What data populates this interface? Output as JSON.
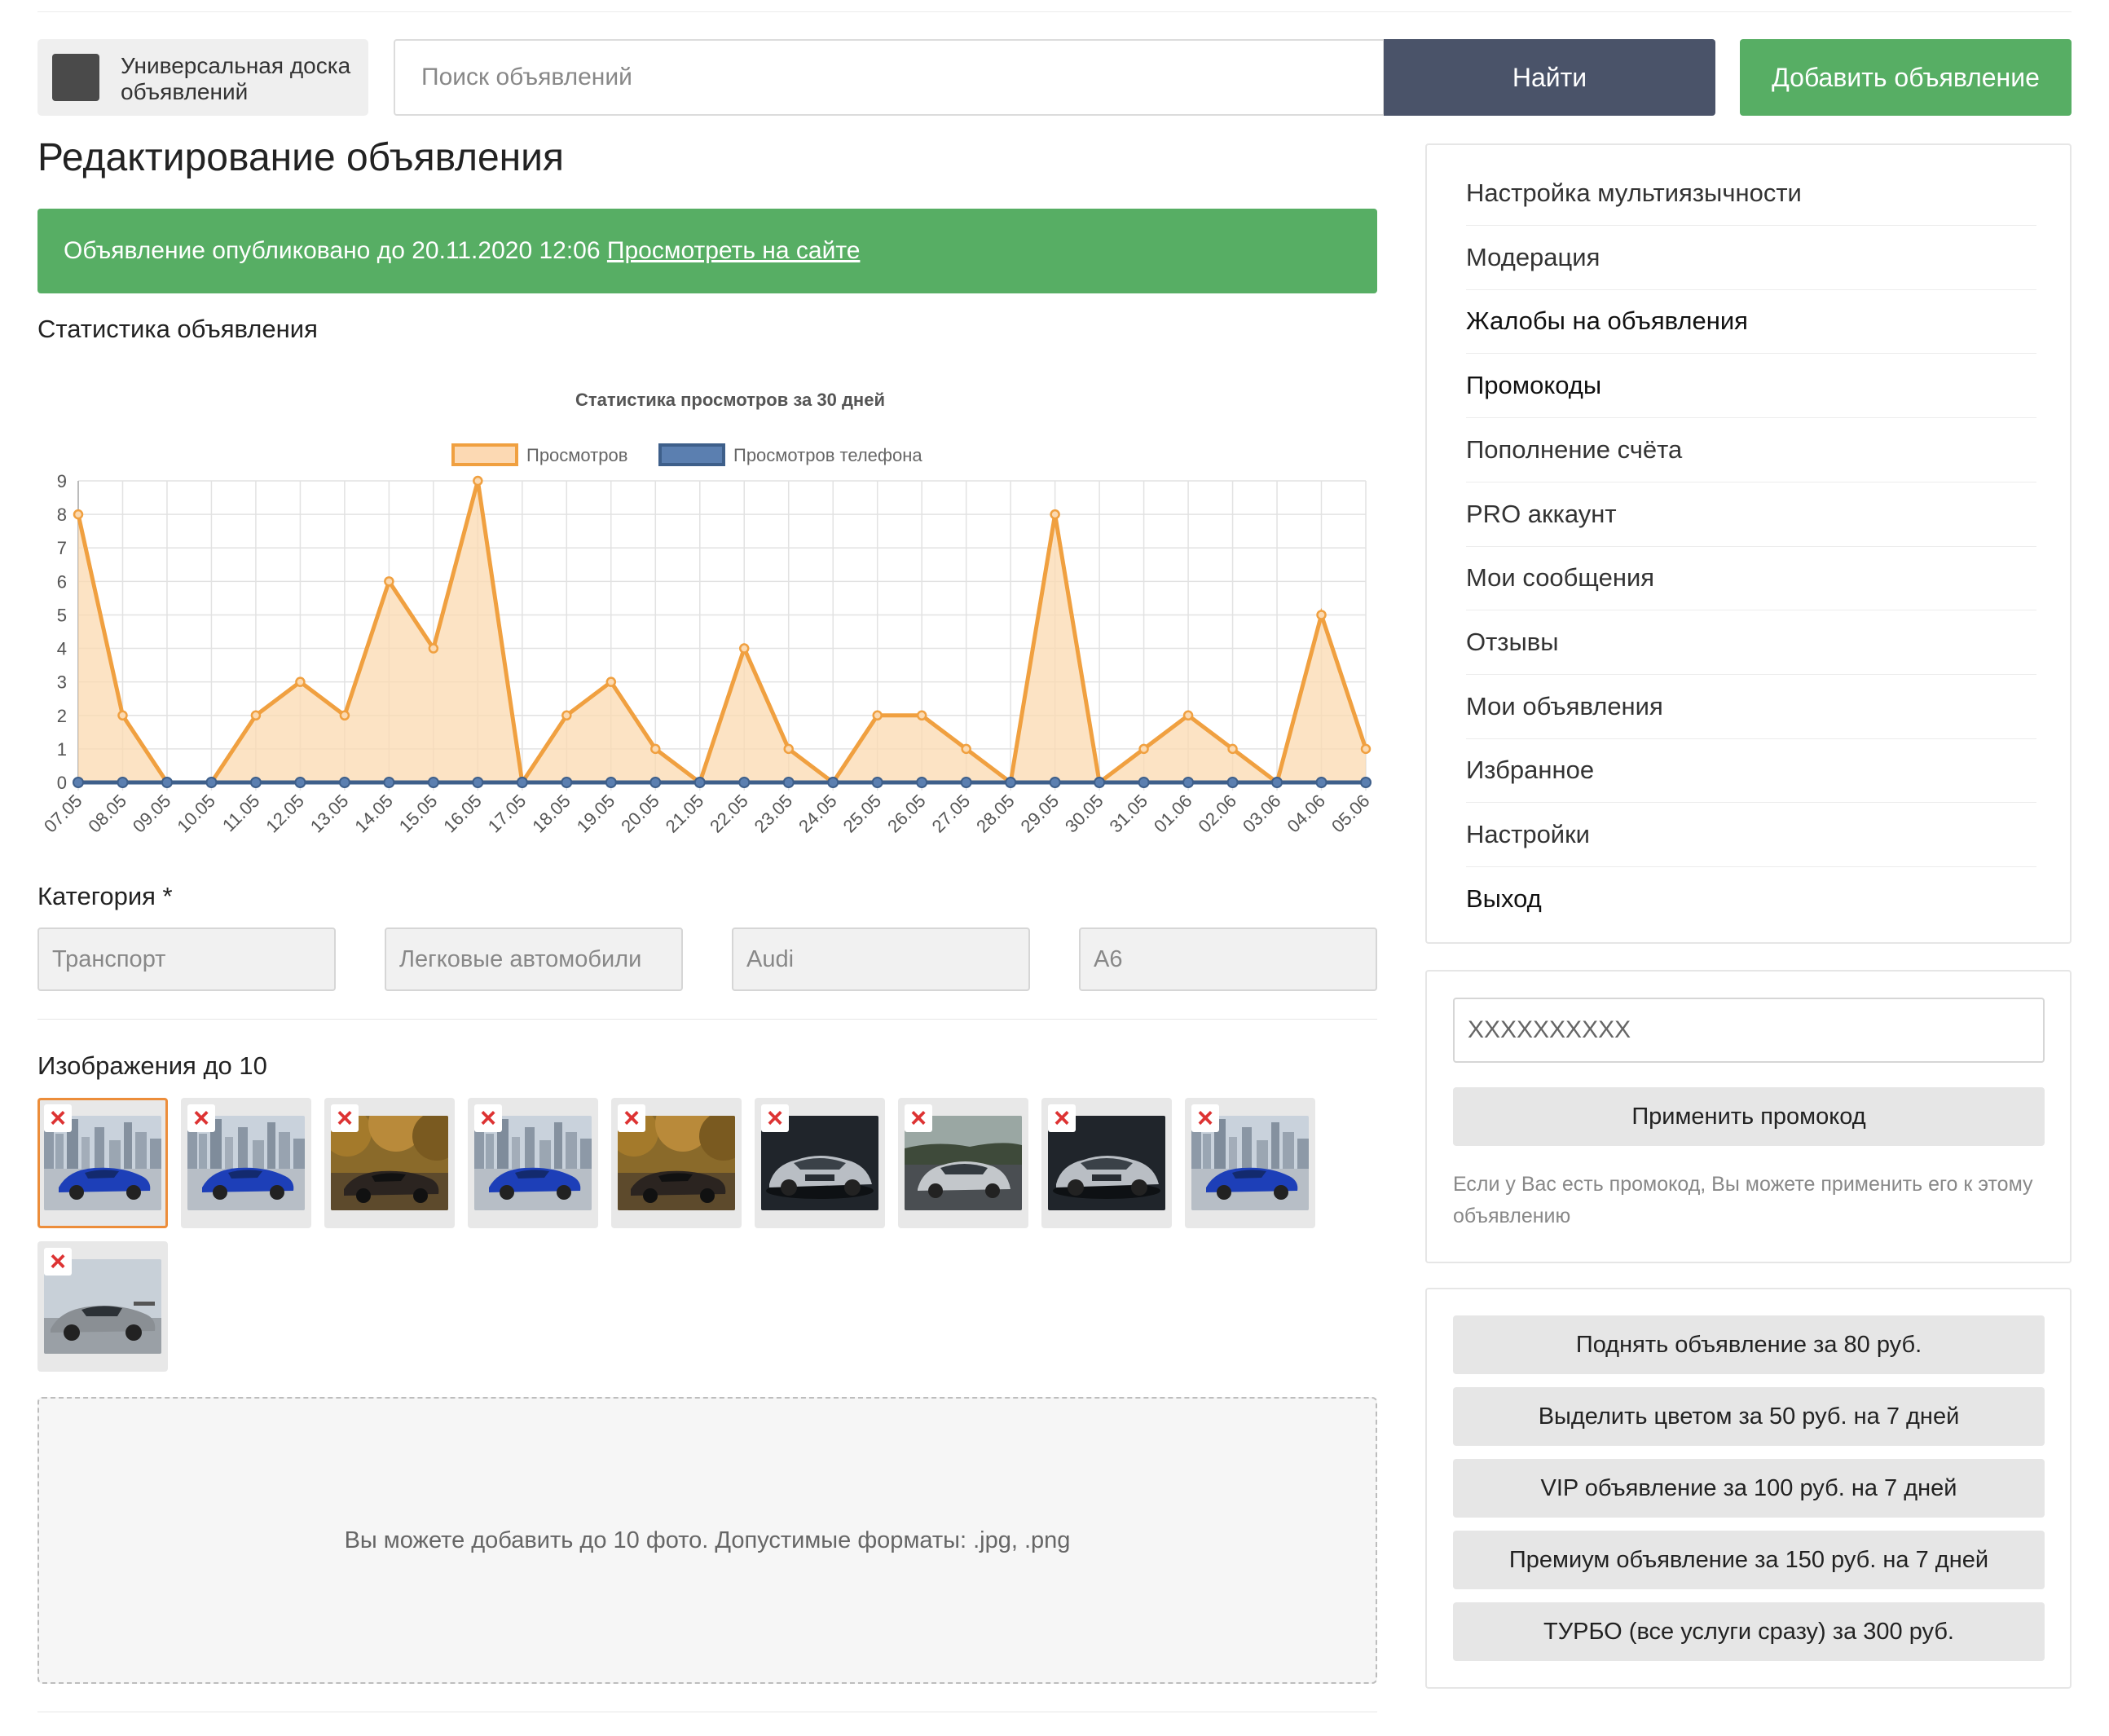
{
  "header": {
    "logo_text": "Универсальная доска объявлений",
    "search_placeholder": "Поиск объявлений",
    "find_button": "Найти",
    "add_button": "Добавить объявление"
  },
  "page": {
    "title": "Редактирование объявления",
    "alert_text": "Объявление опубликовано до 20.11.2020 12:06",
    "alert_link": "Просмотреть на сайте",
    "stats_label": "Статистика объявления",
    "category_label": "Категория *",
    "categories": [
      "Транспорт",
      "Легковые автомобили",
      "Audi",
      "A6"
    ],
    "images_label": "Изображения до 10",
    "dropzone_text": "Вы можете добавить до 10 фото. Допустимые форматы: .jpg, .png"
  },
  "images": [
    {
      "type": "blue-car-city",
      "selected": true
    },
    {
      "type": "blue-car-city",
      "selected": false
    },
    {
      "type": "dark-car-forest",
      "selected": false
    },
    {
      "type": "blue-car-city",
      "selected": false
    },
    {
      "type": "dark-car-forest",
      "selected": false
    },
    {
      "type": "silver-sedan-dark",
      "selected": false
    },
    {
      "type": "silver-sedan-road",
      "selected": false
    },
    {
      "type": "silver-sedan-dark",
      "selected": false
    },
    {
      "type": "blue-car-city",
      "selected": false
    },
    {
      "type": "grey-car-sky",
      "selected": false
    }
  ],
  "colors": {
    "accent_green": "#57ae64",
    "dark_button": "#4a5369",
    "series_views": "#f0a040",
    "series_phone": "#3e5f8a"
  },
  "chart_data": {
    "type": "line",
    "title": "Статистика просмотров за 30 дней",
    "legend_position": "top",
    "grid": true,
    "ylim": [
      0,
      9
    ],
    "yticks": [
      0,
      1,
      2,
      3,
      4,
      5,
      6,
      7,
      8,
      9
    ],
    "categories": [
      "07.05",
      "08.05",
      "09.05",
      "10.05",
      "11.05",
      "12.05",
      "13.05",
      "14.05",
      "15.05",
      "16.05",
      "17.05",
      "18.05",
      "19.05",
      "20.05",
      "21.05",
      "22.05",
      "23.05",
      "24.05",
      "25.05",
      "26.05",
      "27.05",
      "28.05",
      "29.05",
      "30.05",
      "31.05",
      "01.06",
      "02.06",
      "03.06",
      "04.06",
      "05.06"
    ],
    "series": [
      {
        "name": "Просмотров",
        "values": [
          8,
          2,
          0,
          0,
          2,
          3,
          2,
          6,
          4,
          9,
          0,
          2,
          3,
          1,
          0,
          4,
          1,
          0,
          2,
          2,
          1,
          0,
          8,
          0,
          1,
          2,
          1,
          0,
          5,
          1
        ]
      },
      {
        "name": "Просмотров телефона",
        "values": [
          0,
          0,
          0,
          0,
          0,
          0,
          0,
          0,
          0,
          0,
          0,
          0,
          0,
          0,
          0,
          0,
          0,
          0,
          0,
          0,
          0,
          0,
          0,
          0,
          0,
          0,
          0,
          0,
          0,
          0
        ]
      }
    ]
  },
  "sidebar": {
    "menu": [
      {
        "label": "Настройка мультиязычности",
        "dark": false
      },
      {
        "label": "Модерация",
        "dark": false
      },
      {
        "label": "Жалобы на объявления",
        "dark": true
      },
      {
        "label": "Промокоды",
        "dark": true
      },
      {
        "label": "Пополнение счёта",
        "dark": false
      },
      {
        "label": "PRO аккаунт",
        "dark": false
      },
      {
        "label": "Мои сообщения",
        "dark": false
      },
      {
        "label": "Отзывы",
        "dark": false
      },
      {
        "label": "Мои объявления",
        "dark": false
      },
      {
        "label": "Избранное",
        "dark": false
      },
      {
        "label": "Настройки",
        "dark": false
      },
      {
        "label": "Выход",
        "dark": true
      }
    ],
    "promo_value": "XXXXXXXXXX",
    "promo_button": "Применить промокод",
    "promo_hint": "Если у Вас есть промокод, Вы можете применить его к этому объявлению",
    "services": [
      "Поднять объявление за 80 руб.",
      "Выделить цветом за 50 руб. на 7 дней",
      "VIP объявление за 100 руб. на 7 дней",
      "Премиум объявление за 150 руб. на 7 дней",
      "ТУРБО (все услуги сразу) за 300 руб."
    ]
  }
}
